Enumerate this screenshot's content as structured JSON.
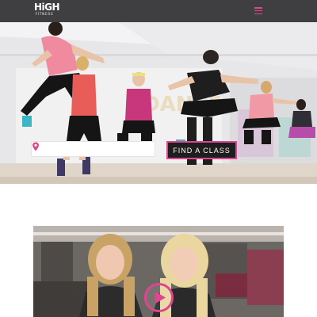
{
  "header": {
    "logo_main": "HiGH",
    "logo_sub": "fitness",
    "menu_icon": "hamburger-menu-icon",
    "accent_color": "#e0458f",
    "background_color": "#3f3f41"
  },
  "hero": {
    "wall_letters": "DANCE",
    "location_search": {
      "placeholder": "",
      "value": "",
      "icon": "location-pin-icon"
    },
    "find_class_label": "FIND A CLASS"
  },
  "video": {
    "play_icon": "play-icon"
  }
}
